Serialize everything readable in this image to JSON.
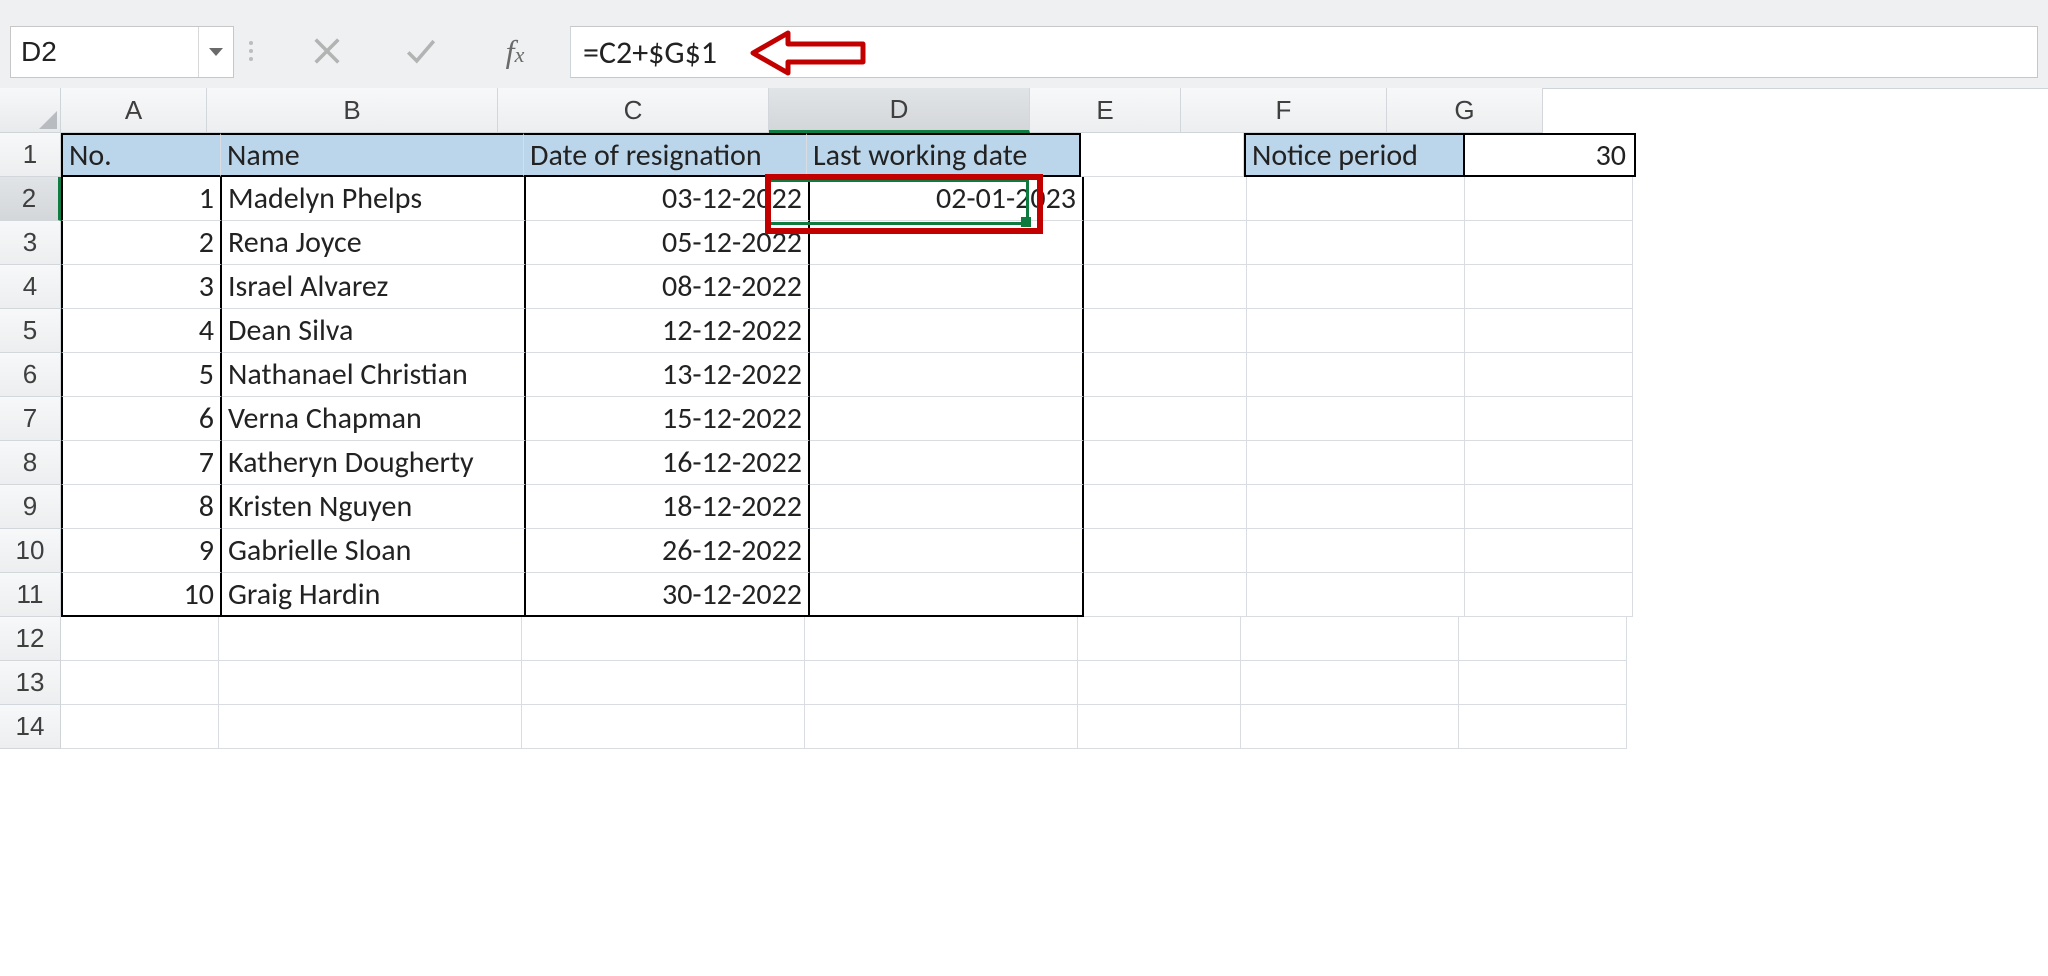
{
  "namebox": {
    "value": "D2"
  },
  "formula": {
    "value": "=C2+$G$1"
  },
  "columns": [
    "A",
    "B",
    "C",
    "D",
    "E",
    "F",
    "G"
  ],
  "selected_column": "D",
  "selected_row": 2,
  "headers": {
    "A": "No.",
    "B": "Name",
    "C": "Date of resignation",
    "D": "Last working date",
    "F": "Notice period"
  },
  "notice_period": 30,
  "rows": [
    {
      "no": 1,
      "name": "Madelyn Phelps",
      "resign": "03-12-2022",
      "last": "02-01-2023"
    },
    {
      "no": 2,
      "name": "Rena Joyce",
      "resign": "05-12-2022",
      "last": ""
    },
    {
      "no": 3,
      "name": "Israel Alvarez",
      "resign": "08-12-2022",
      "last": ""
    },
    {
      "no": 4,
      "name": "Dean Silva",
      "resign": "12-12-2022",
      "last": ""
    },
    {
      "no": 5,
      "name": "Nathanael Christian",
      "resign": "13-12-2022",
      "last": ""
    },
    {
      "no": 6,
      "name": "Verna Chapman",
      "resign": "15-12-2022",
      "last": ""
    },
    {
      "no": 7,
      "name": "Katheryn Dougherty",
      "resign": "16-12-2022",
      "last": ""
    },
    {
      "no": 8,
      "name": "Kristen Nguyen",
      "resign": "18-12-2022",
      "last": ""
    },
    {
      "no": 9,
      "name": "Gabrielle Sloan",
      "resign": "26-12-2022",
      "last": ""
    },
    {
      "no": 10,
      "name": "Graig Hardin",
      "resign": "30-12-2022",
      "last": ""
    }
  ],
  "visible_blank_rows": [
    12,
    13,
    14
  ]
}
